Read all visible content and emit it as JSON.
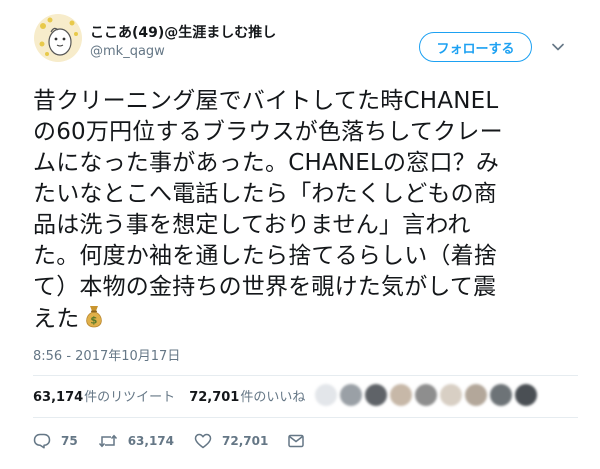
{
  "user": {
    "display_name": "ここあ(49)@生涯ましむ推し",
    "handle": "@mk_qagw"
  },
  "follow_button": {
    "label": "フォローする"
  },
  "tweet": {
    "lines": [
      "昔クリーニング屋でバイトしてた時CHANEL",
      "の60万円位するブラウスが色落ちしてクレー",
      "ムになった事があった。CHANELの窓口？み",
      "たいなとこへ電話したら「わたくしどもの商",
      "品は洗う事を想定しておりません」言われ",
      "た。何度か袖を通したら捨てるらしい（着捨",
      "て）本物の金持ちの世界を覗けた気がして震",
      "えた"
    ],
    "emoji_icon": "money-bag-icon",
    "timestamp": "8:56 - 2017年10月17日"
  },
  "stats": {
    "retweets_count": "63,174",
    "retweets_label": "件のリツイート",
    "likes_count": "72,701",
    "likes_label": "件のいいね"
  },
  "actions": {
    "reply_count": "75",
    "retweet_count": "63,174",
    "like_count": "72,701"
  },
  "colors": {
    "accent": "#1da1f2",
    "secondary_text": "#657786",
    "divider": "#e6ecf0"
  }
}
